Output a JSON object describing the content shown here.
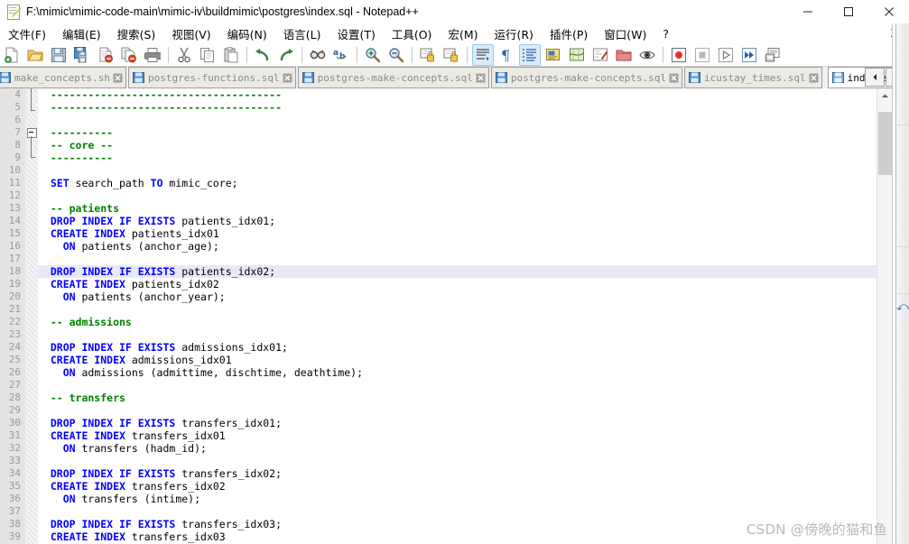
{
  "window": {
    "title": "F:\\mimic\\mimic-code-main\\mimic-iv\\buildmimic\\postgres\\index.sql - Notepad++",
    "app_icon": "notepadpp-icon",
    "minimize_label": "—",
    "maximize_label": "☐",
    "close_label": "✕"
  },
  "menubar": {
    "items": [
      {
        "label": "文件(F)",
        "name": "menu-file"
      },
      {
        "label": "编辑(E)",
        "name": "menu-edit"
      },
      {
        "label": "搜索(S)",
        "name": "menu-search"
      },
      {
        "label": "视图(V)",
        "name": "menu-view"
      },
      {
        "label": "编码(N)",
        "name": "menu-encoding"
      },
      {
        "label": "语言(L)",
        "name": "menu-language"
      },
      {
        "label": "设置(T)",
        "name": "menu-settings"
      },
      {
        "label": "工具(O)",
        "name": "menu-tools"
      },
      {
        "label": "宏(M)",
        "name": "menu-macro"
      },
      {
        "label": "运行(R)",
        "name": "menu-run"
      },
      {
        "label": "插件(P)",
        "name": "menu-plugins"
      },
      {
        "label": "窗口(W)",
        "name": "menu-window"
      },
      {
        "label": "?",
        "name": "menu-help"
      }
    ],
    "close_doc_label": "X"
  },
  "toolbar": {
    "buttons": [
      {
        "name": "new-file-icon",
        "active": false
      },
      {
        "name": "open-file-icon",
        "active": false
      },
      {
        "name": "save-icon",
        "active": false
      },
      {
        "name": "save-all-icon",
        "active": false
      },
      {
        "name": "close-file-icon",
        "active": false
      },
      {
        "name": "close-all-icon",
        "active": false
      },
      {
        "name": "print-icon",
        "active": false
      },
      {
        "name": "sep",
        "active": false
      },
      {
        "name": "cut-icon",
        "active": false
      },
      {
        "name": "copy-icon",
        "active": false
      },
      {
        "name": "paste-icon",
        "active": false
      },
      {
        "name": "sep",
        "active": false
      },
      {
        "name": "undo-icon",
        "active": false
      },
      {
        "name": "redo-icon",
        "active": false
      },
      {
        "name": "sep",
        "active": false
      },
      {
        "name": "find-icon",
        "active": false
      },
      {
        "name": "replace-icon",
        "active": false
      },
      {
        "name": "sep",
        "active": false
      },
      {
        "name": "zoom-in-icon",
        "active": false
      },
      {
        "name": "zoom-out-icon",
        "active": false
      },
      {
        "name": "sep",
        "active": false
      },
      {
        "name": "sync-vertical-scroll-icon",
        "active": false
      },
      {
        "name": "sync-horizontal-scroll-icon",
        "active": false
      },
      {
        "name": "sep",
        "active": false
      },
      {
        "name": "word-wrap-icon",
        "active": true
      },
      {
        "name": "show-all-characters-icon",
        "active": false
      },
      {
        "name": "indent-guide-icon",
        "active": true
      },
      {
        "name": "user-defined-language-icon",
        "active": false
      },
      {
        "name": "document-map-icon",
        "active": false
      },
      {
        "name": "function-list-icon",
        "active": false
      },
      {
        "name": "folder-as-workspace-icon",
        "active": false
      },
      {
        "name": "monitoring-icon",
        "active": false
      },
      {
        "name": "sep",
        "active": false
      },
      {
        "name": "macro-record-icon",
        "active": false
      },
      {
        "name": "macro-stop-icon",
        "active": false
      },
      {
        "name": "macro-play-icon",
        "active": false
      },
      {
        "name": "macro-playback-multiple-icon",
        "active": false
      },
      {
        "name": "macro-save-icon",
        "active": false
      }
    ]
  },
  "tabs": {
    "items": [
      {
        "label": "make_concepts.sh",
        "active": false,
        "name": "tab-make-concepts-sh"
      },
      {
        "label": "postgres-functions.sql",
        "active": false,
        "name": "tab-postgres-functions-sql"
      },
      {
        "label": "postgres-make-concepts.sql",
        "active": false,
        "name": "tab-postgres-make-concepts-sql-1"
      },
      {
        "label": "postgres-make-concepts.sql",
        "active": false,
        "name": "tab-postgres-make-concepts-sql-2"
      },
      {
        "label": "icustay_times.sql",
        "active": false,
        "name": "tab-icustay-times-sql"
      },
      {
        "label": "index.sql",
        "active": true,
        "name": "tab-index-sql"
      }
    ],
    "nav_prev": "◄",
    "nav_next": "►",
    "highlight_color": "#ff2d1a"
  },
  "editor": {
    "first_line_number": 4,
    "current_line_number": 18,
    "colors": {
      "keyword": "#0000ff",
      "comment": "#008000",
      "text": "#000000",
      "current_line_bg": "#e8eaf8",
      "gutter_bg": "#e4e4e4"
    },
    "lines": [
      {
        "n": 4,
        "tokens": [
          {
            "t": "cm",
            "s": "  -------------------------------------"
          }
        ]
      },
      {
        "n": 5,
        "tokens": [
          {
            "t": "cm",
            "s": "  -------------------------------------"
          }
        ]
      },
      {
        "n": 6,
        "tokens": []
      },
      {
        "n": 7,
        "tokens": [
          {
            "t": "cm",
            "s": "  ----------"
          }
        ]
      },
      {
        "n": 8,
        "tokens": [
          {
            "t": "cm",
            "s": "  -- core --"
          }
        ]
      },
      {
        "n": 9,
        "tokens": [
          {
            "t": "cm",
            "s": "  ----------"
          }
        ]
      },
      {
        "n": 10,
        "tokens": []
      },
      {
        "n": 11,
        "tokens": [
          {
            "t": "kw",
            "s": "  SET"
          },
          {
            "t": "tx",
            "s": " search_path "
          },
          {
            "t": "kw",
            "s": "TO"
          },
          {
            "t": "tx",
            "s": " mimic_core;"
          }
        ]
      },
      {
        "n": 12,
        "tokens": []
      },
      {
        "n": 13,
        "tokens": [
          {
            "t": "cm",
            "s": "  -- patients"
          }
        ]
      },
      {
        "n": 14,
        "tokens": [
          {
            "t": "kw",
            "s": "  DROP INDEX IF EXISTS"
          },
          {
            "t": "tx",
            "s": " patients_idx01;"
          }
        ]
      },
      {
        "n": 15,
        "tokens": [
          {
            "t": "kw",
            "s": "  CREATE INDEX"
          },
          {
            "t": "tx",
            "s": " patients_idx01"
          }
        ]
      },
      {
        "n": 16,
        "tokens": [
          {
            "t": "kw",
            "s": "    ON"
          },
          {
            "t": "tx",
            "s": " patients (anchor_age);"
          }
        ]
      },
      {
        "n": 17,
        "tokens": []
      },
      {
        "n": 18,
        "tokens": [
          {
            "t": "kw",
            "s": "  DROP INDEX IF EXISTS"
          },
          {
            "t": "tx",
            "s": " patients_idx02;"
          }
        ]
      },
      {
        "n": 19,
        "tokens": [
          {
            "t": "kw",
            "s": "  CREATE INDEX"
          },
          {
            "t": "tx",
            "s": " patients_idx02"
          }
        ]
      },
      {
        "n": 20,
        "tokens": [
          {
            "t": "kw",
            "s": "    ON"
          },
          {
            "t": "tx",
            "s": " patients (anchor_year);"
          }
        ]
      },
      {
        "n": 21,
        "tokens": []
      },
      {
        "n": 22,
        "tokens": [
          {
            "t": "cm",
            "s": "  -- admissions"
          }
        ]
      },
      {
        "n": 23,
        "tokens": []
      },
      {
        "n": 24,
        "tokens": [
          {
            "t": "kw",
            "s": "  DROP INDEX IF EXISTS"
          },
          {
            "t": "tx",
            "s": " admissions_idx01;"
          }
        ]
      },
      {
        "n": 25,
        "tokens": [
          {
            "t": "kw",
            "s": "  CREATE INDEX"
          },
          {
            "t": "tx",
            "s": " admissions_idx01"
          }
        ]
      },
      {
        "n": 26,
        "tokens": [
          {
            "t": "kw",
            "s": "    ON"
          },
          {
            "t": "tx",
            "s": " admissions (admittime, dischtime, deathtime);"
          }
        ]
      },
      {
        "n": 27,
        "tokens": []
      },
      {
        "n": 28,
        "tokens": [
          {
            "t": "cm",
            "s": "  -- transfers"
          }
        ]
      },
      {
        "n": 29,
        "tokens": []
      },
      {
        "n": 30,
        "tokens": [
          {
            "t": "kw",
            "s": "  DROP INDEX IF EXISTS"
          },
          {
            "t": "tx",
            "s": " transfers_idx01;"
          }
        ]
      },
      {
        "n": 31,
        "tokens": [
          {
            "t": "kw",
            "s": "  CREATE INDEX"
          },
          {
            "t": "tx",
            "s": " transfers_idx01"
          }
        ]
      },
      {
        "n": 32,
        "tokens": [
          {
            "t": "kw",
            "s": "    ON"
          },
          {
            "t": "tx",
            "s": " transfers (hadm_id);"
          }
        ]
      },
      {
        "n": 33,
        "tokens": []
      },
      {
        "n": 34,
        "tokens": [
          {
            "t": "kw",
            "s": "  DROP INDEX IF EXISTS"
          },
          {
            "t": "tx",
            "s": " transfers_idx02;"
          }
        ]
      },
      {
        "n": 35,
        "tokens": [
          {
            "t": "kw",
            "s": "  CREATE INDEX"
          },
          {
            "t": "tx",
            "s": " transfers_idx02"
          }
        ]
      },
      {
        "n": 36,
        "tokens": [
          {
            "t": "kw",
            "s": "    ON"
          },
          {
            "t": "tx",
            "s": " transfers (intime);"
          }
        ]
      },
      {
        "n": 37,
        "tokens": []
      },
      {
        "n": 38,
        "tokens": [
          {
            "t": "kw",
            "s": "  DROP INDEX IF EXISTS"
          },
          {
            "t": "tx",
            "s": " transfers_idx03;"
          }
        ]
      },
      {
        "n": 39,
        "tokens": [
          {
            "t": "kw",
            "s": "  CREATE INDEX"
          },
          {
            "t": "tx",
            "s": " transfers_idx03"
          }
        ]
      }
    ]
  },
  "watermark": {
    "text": "CSDN @傍晚的猫和鱼"
  }
}
